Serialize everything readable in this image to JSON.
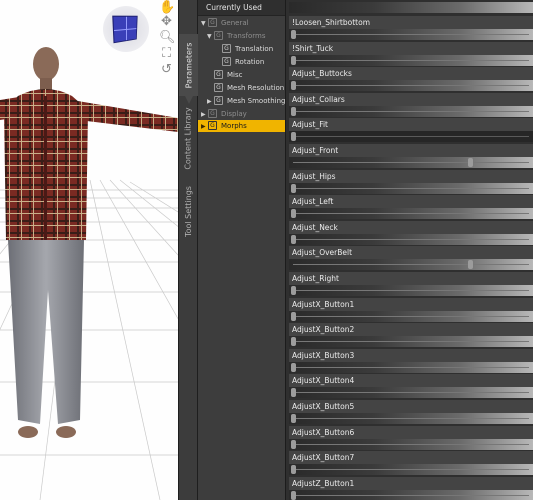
{
  "viewport": {
    "tools": [
      "hand-icon",
      "orbit-icon",
      "zoom-icon",
      "frame-icon",
      "reset-icon"
    ]
  },
  "side_tabs": [
    "Parameters",
    "Content Library",
    "Tool Settings"
  ],
  "tree": {
    "header": "Currently Used",
    "items": [
      {
        "label": "General",
        "expander": "▼",
        "dim": true
      },
      {
        "label": "Transforms",
        "expander": "▼",
        "dim": true
      },
      {
        "label": "Translation",
        "expander": "",
        "dim": false
      },
      {
        "label": "Rotation",
        "expander": "",
        "dim": false
      },
      {
        "label": "Misc",
        "expander": "",
        "dim": false
      },
      {
        "label": "Mesh Resolution",
        "expander": "",
        "dim": false
      },
      {
        "label": "Mesh Smoothing",
        "expander": "▶",
        "dim": false
      },
      {
        "label": "Display",
        "expander": "▶",
        "dim": true
      },
      {
        "label": "Morphs",
        "expander": "▶",
        "dim": false,
        "selected": true
      }
    ]
  },
  "parameters": [
    {
      "name": "!Loosen_Shirtbottom",
      "value": 0.0
    },
    {
      "name": "!Shirt_Tuck",
      "value": 0.0
    },
    {
      "name": "Adjust_Buttocks",
      "value": 0.0
    },
    {
      "name": "Adjust_Collars",
      "value": 0.0
    },
    {
      "name": "Adjust_Fit",
      "value": 0.0
    },
    {
      "name": "Adjust_Front",
      "value": 0.75
    },
    {
      "name": "Adjust_Hips",
      "value": 0.0
    },
    {
      "name": "Adjust_Left",
      "value": 0.0
    },
    {
      "name": "Adjust_Neck",
      "value": 0.0
    },
    {
      "name": "Adjust_OverBelt",
      "value": 0.75
    },
    {
      "name": "Adjust_Right",
      "value": 0.0
    },
    {
      "name": "AdjustX_Button1",
      "value": 0.0
    },
    {
      "name": "AdjustX_Button2",
      "value": 0.0
    },
    {
      "name": "AdjustX_Button3",
      "value": 0.0
    },
    {
      "name": "AdjustX_Button4",
      "value": 0.0
    },
    {
      "name": "AdjustX_Button5",
      "value": 0.0
    },
    {
      "name": "AdjustX_Button6",
      "value": 0.0
    },
    {
      "name": "AdjustX_Button7",
      "value": 0.0
    },
    {
      "name": "AdjustZ_Button1",
      "value": 0.0
    }
  ],
  "colors": {
    "selection": "#f0b400",
    "panel": "#2f2f2f"
  }
}
